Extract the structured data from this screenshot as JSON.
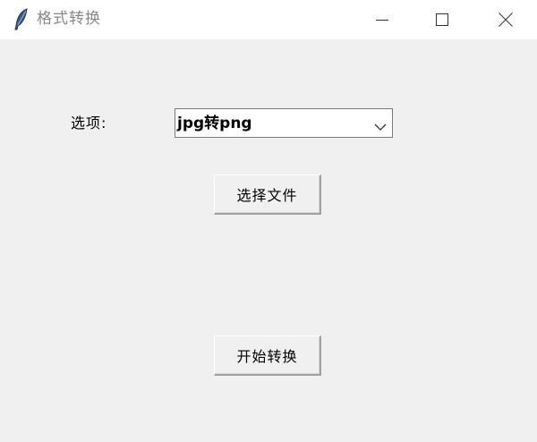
{
  "window": {
    "title": "格式转换",
    "icon": "feather-icon",
    "controls": {
      "minimize": "minimize-icon",
      "maximize": "maximize-icon",
      "close": "close-icon"
    }
  },
  "form": {
    "option_label": "选项:",
    "option_value": "jpg转png",
    "select_file_label": "选择文件",
    "start_label": "开始转换"
  },
  "colors": {
    "background": "#f0f0f0",
    "titlebar": "#ffffff",
    "title_text": "#888888"
  }
}
